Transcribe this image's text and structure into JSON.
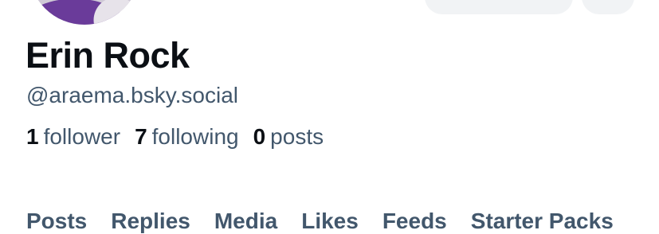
{
  "profile": {
    "display_name": "Erin Rock",
    "handle": "@araema.bsky.social"
  },
  "stats": {
    "followers_count": "1",
    "followers_label": "follower",
    "following_count": "7",
    "following_label": "following",
    "posts_count": "0",
    "posts_label": "posts"
  },
  "tabs": [
    "Posts",
    "Replies",
    "Media",
    "Likes",
    "Feeds",
    "Starter Packs"
  ],
  "colors": {
    "primary_text": "#0b0f14",
    "secondary_text": "#42576c",
    "button_bg": "#f1f3f5",
    "avatar_accent": "#6a3b9a"
  }
}
